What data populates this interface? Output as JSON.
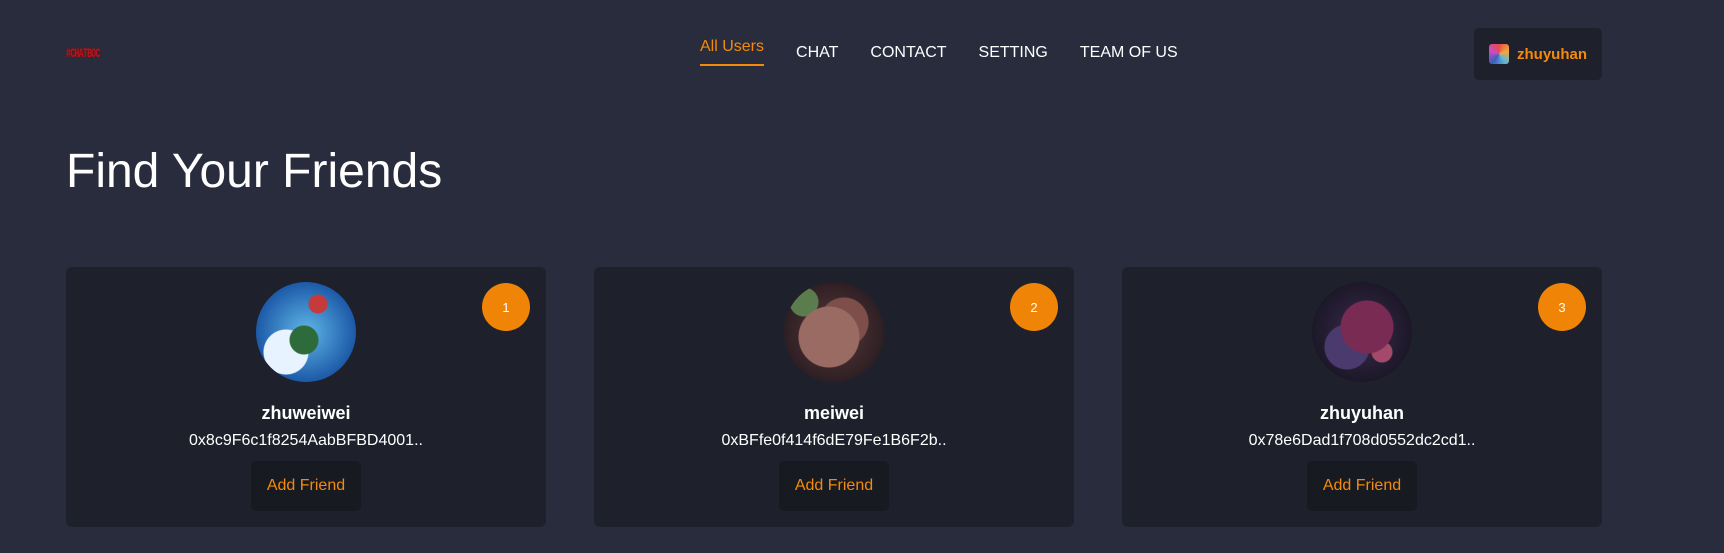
{
  "header": {
    "logo_text": "#CHATBOC",
    "nav": [
      {
        "label": "All Users",
        "active": true
      },
      {
        "label": "CHAT",
        "active": false
      },
      {
        "label": "CONTACT",
        "active": false
      },
      {
        "label": "SETTING",
        "active": false
      },
      {
        "label": "TEAM OF US",
        "active": false
      }
    ],
    "current_user": "zhuyuhan"
  },
  "page_title": "Find Your Friends",
  "users": [
    {
      "rank": "1",
      "name": "zhuweiwei",
      "address": "0x8c9F6c1f8254AabBFBD4001..",
      "action": "Add Friend"
    },
    {
      "rank": "2",
      "name": "meiwei",
      "address": "0xBFfe0f414f6dE79Fe1B6F2b..",
      "action": "Add Friend"
    },
    {
      "rank": "3",
      "name": "zhuyuhan",
      "address": "0x78e6Dad1f708d0552dc2cd1..",
      "action": "Add Friend"
    }
  ],
  "colors": {
    "background": "#282c3d",
    "card": "#1e212c",
    "accent": "#f48a0b"
  }
}
